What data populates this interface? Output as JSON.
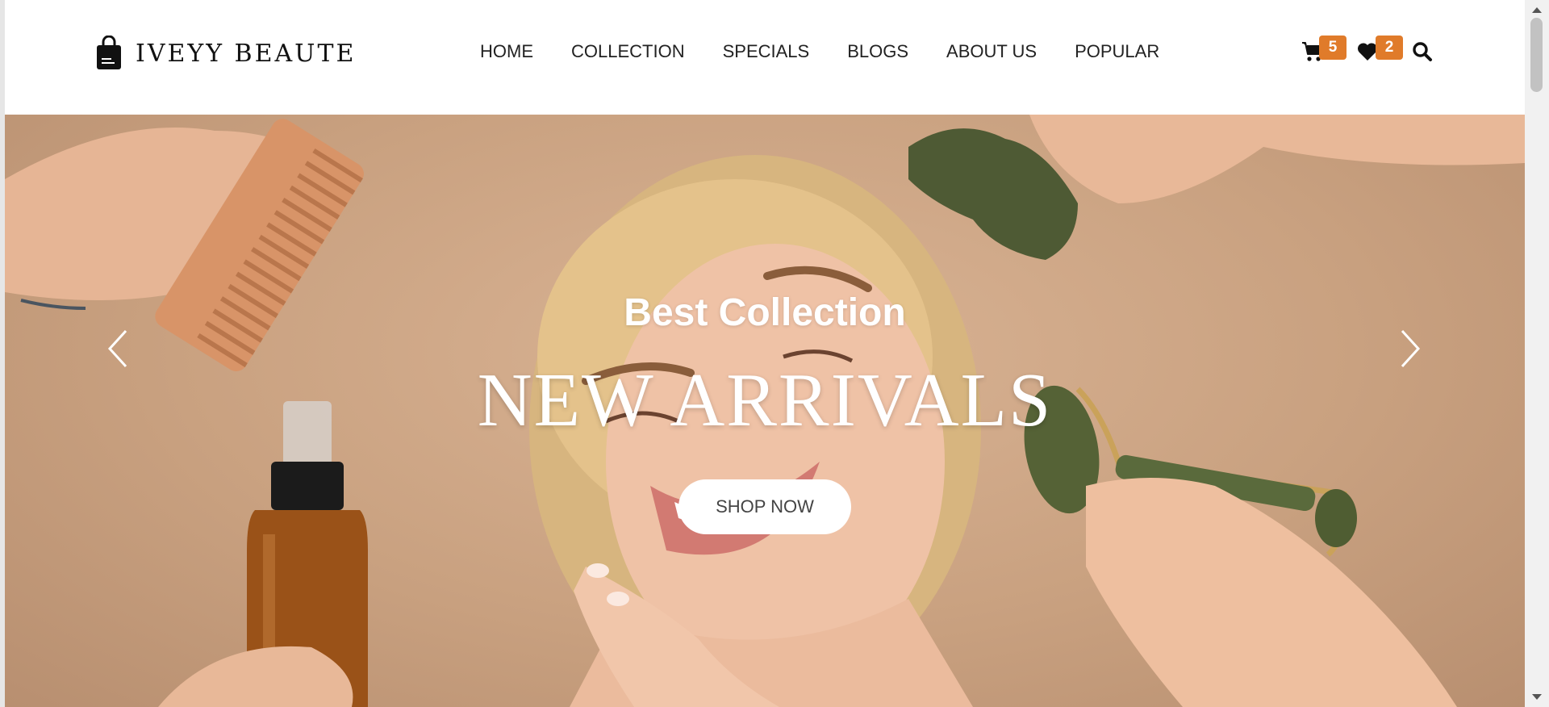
{
  "brand": {
    "name": "IVEYY BEAUTE"
  },
  "nav": {
    "items": [
      {
        "label": "HOME"
      },
      {
        "label": "COLLECTION"
      },
      {
        "label": "SPECIALS"
      },
      {
        "label": "BLOGS"
      },
      {
        "label": "ABOUT US"
      },
      {
        "label": "POPULAR"
      }
    ]
  },
  "header_icons": {
    "cart": {
      "icon": "cart-icon",
      "count": "5"
    },
    "wishlist": {
      "icon": "heart-icon",
      "count": "2"
    },
    "search": {
      "icon": "search-icon"
    }
  },
  "hero": {
    "subtitle": "Best Collection",
    "title": "NEW ARRIVALS",
    "cta_label": "SHOP NOW",
    "prev_icon": "chevron-left-icon",
    "next_icon": "chevron-right-icon"
  },
  "colors": {
    "badge": "#e07b2a",
    "hero_background": "#c9a180",
    "text_dark": "#222222"
  }
}
